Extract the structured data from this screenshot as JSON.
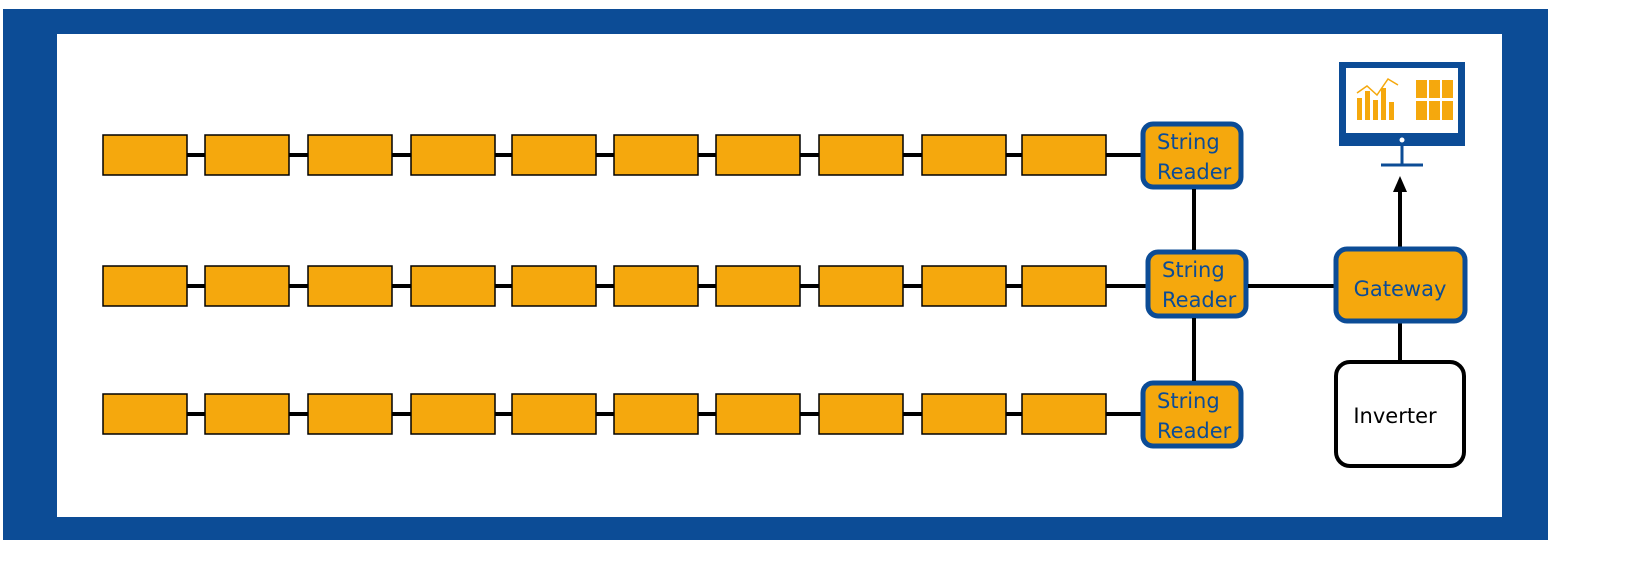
{
  "colors": {
    "frame": "#0c4c96",
    "panel": "#f5a80d",
    "node_border": "#0c4c96",
    "node_text": "#0c4c96",
    "wire": "#000000"
  },
  "strings": [
    {
      "panel_count": 10,
      "reader": {
        "line1": "String",
        "line2": "Reader"
      }
    },
    {
      "panel_count": 10,
      "reader": {
        "line1": "String",
        "line2": "Reader"
      }
    },
    {
      "panel_count": 10,
      "reader": {
        "line1": "String",
        "line2": "Reader"
      }
    }
  ],
  "gateway": {
    "label": "Gateway"
  },
  "inverter": {
    "label": "Inverter"
  },
  "monitor": {
    "icons": [
      "bar-chart-icon",
      "grid-dashboard-icon"
    ]
  }
}
